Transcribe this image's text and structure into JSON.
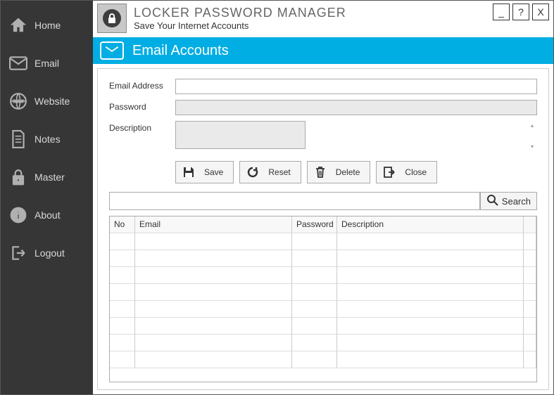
{
  "header": {
    "title": "LOCKER PASSWORD MANAGER",
    "subtitle": "Save Your Internet Accounts",
    "win": {
      "min": "_",
      "help": "?",
      "close": "X"
    }
  },
  "sidebar": {
    "items": [
      {
        "label": "Home"
      },
      {
        "label": "Email"
      },
      {
        "label": "Website"
      },
      {
        "label": "Notes"
      },
      {
        "label": "Master"
      },
      {
        "label": "About"
      },
      {
        "label": "Logout"
      }
    ]
  },
  "section": {
    "title": "Email Accounts"
  },
  "form": {
    "email_label": "Email Address",
    "password_label": "Password",
    "description_label": "Description",
    "email_value": "",
    "password_value": "",
    "description_value": ""
  },
  "buttons": {
    "save": "Save",
    "reset": "Reset",
    "delete": "Delete",
    "close": "Close"
  },
  "search": {
    "value": "",
    "button": "Search"
  },
  "grid": {
    "columns": {
      "no": "No",
      "email": "Email",
      "password": "Password",
      "description": "Description"
    },
    "rows": []
  }
}
